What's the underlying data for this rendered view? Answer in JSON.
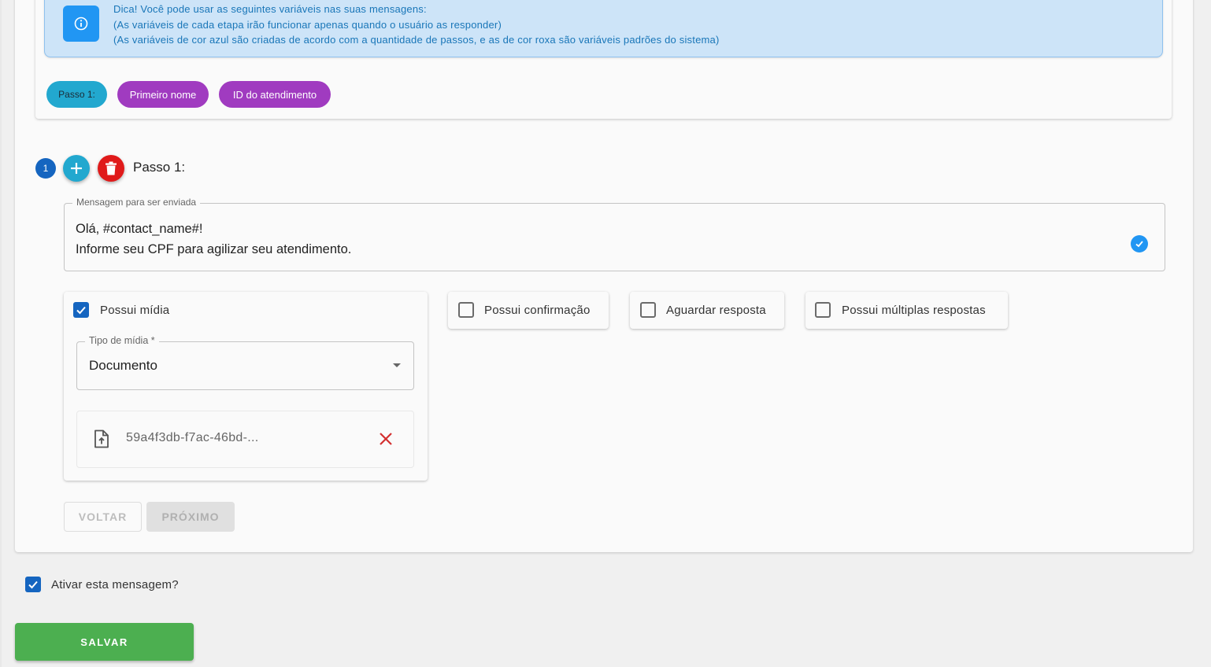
{
  "tip": {
    "line1": "Dica! Você pode usar as seguintes variáveis nas suas mensagens:",
    "line2": "(As variáveis de cada etapa irão funcionar apenas quando o usuário as responder)",
    "line3": "(As variáveis de cor azul são criadas de acordo com a quantidade de passos, e as de cor roxa são variáveis padrões do sistema)",
    "icon": "info-icon",
    "color": "#2196f3"
  },
  "chips": {
    "step": "Passo 1:",
    "first_name": "Primeiro nome",
    "ticket_id": "ID do atendimento",
    "blue": "#22a8cf",
    "purple": "#a03bc0"
  },
  "step": {
    "number": "1",
    "title": "Passo 1:",
    "add_icon": "plus-icon",
    "delete_icon": "trash-icon"
  },
  "message": {
    "label": "Mensagem para ser enviada",
    "line1": "Olá, #contact_name#!",
    "line2": "Informe seu CPF para agilizar seu atendimento.",
    "status_icon": "check-circle-icon"
  },
  "media": {
    "has_media_label": "Possui mídia",
    "has_media_checked": true,
    "type_label": "Tipo de mídia *",
    "type_value": "Documento",
    "file_name": "59a4f3db-f7ac-46bd-...",
    "file_icon": "file-upload-icon",
    "remove_icon": "close-icon"
  },
  "options": {
    "confirmation": "Possui confirmação",
    "wait_response": "Aguardar resposta",
    "multiple_responses": "Possui múltiplas respostas"
  },
  "nav": {
    "back": "VOLTAR",
    "next": "PRÓXIMO"
  },
  "activate": {
    "label": "Ativar esta mensagem?",
    "checked": true
  },
  "save": {
    "label": "SALVAR",
    "color": "#4caf50"
  }
}
